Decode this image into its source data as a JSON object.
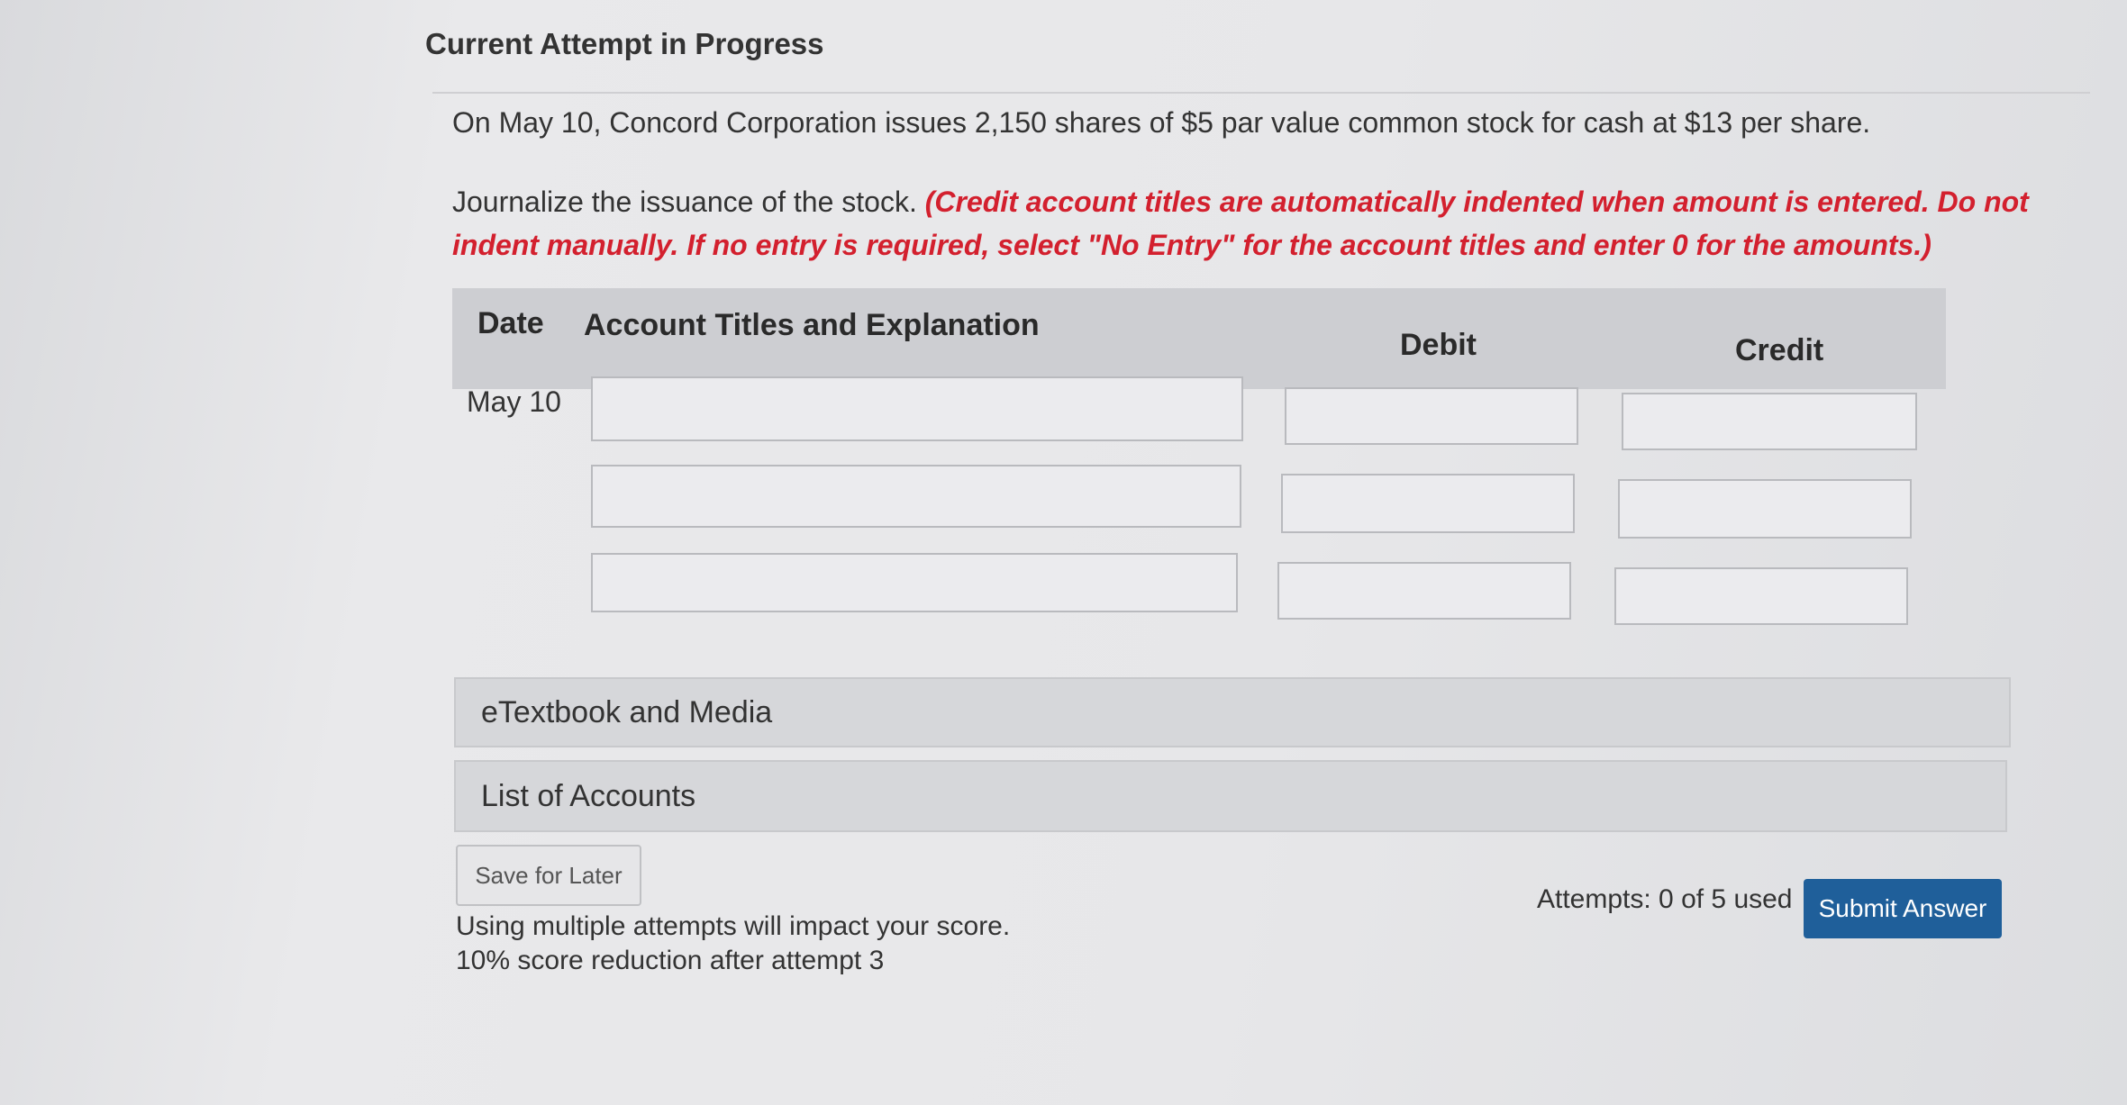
{
  "header": {
    "title": "Current Attempt in Progress"
  },
  "question": {
    "text": "On May 10, Concord Corporation issues 2,150 shares of $5 par value common stock for cash at $13 per share.",
    "instruction_plain": "Journalize the issuance of the stock. ",
    "instruction_red": "(Credit account titles are automatically indented when amount is entered. Do not indent manually. If no entry is required, select \"No Entry\" for the account titles and enter 0 for the amounts.)"
  },
  "journal": {
    "headers": {
      "date": "Date",
      "account": "Account Titles and Explanation",
      "debit": "Debit",
      "credit": "Credit"
    },
    "rows": [
      {
        "date": "May 10",
        "account": "",
        "debit": "",
        "credit": ""
      },
      {
        "date": "",
        "account": "",
        "debit": "",
        "credit": ""
      },
      {
        "date": "",
        "account": "",
        "debit": "",
        "credit": ""
      }
    ]
  },
  "panels": {
    "etextbook": "eTextbook and Media",
    "accounts": "List of Accounts"
  },
  "footer": {
    "save_label": "Save for Later",
    "note_line1": "Using multiple attempts will impact your score.",
    "note_line2": "10% score reduction after attempt 3",
    "attempts": "Attempts: 0 of 5 used",
    "submit_label": "Submit Answer"
  }
}
